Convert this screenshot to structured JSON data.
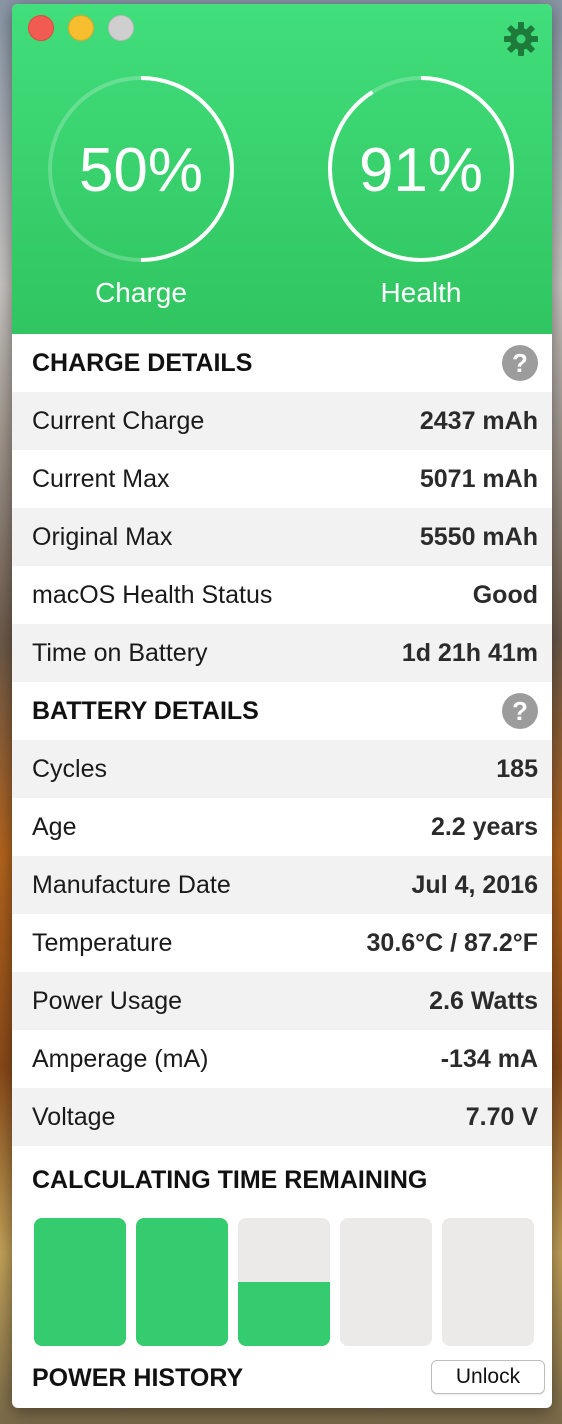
{
  "header": {
    "charge": {
      "value": "50%",
      "label": "Charge",
      "fraction": 0.5
    },
    "health": {
      "value": "91%",
      "label": "Health",
      "fraction": 0.91
    },
    "settings_icon": "gear-icon"
  },
  "charge_details": {
    "title": "CHARGE DETAILS",
    "help": "?",
    "rows": [
      {
        "label": "Current Charge",
        "value": "2437 mAh"
      },
      {
        "label": "Current Max",
        "value": "5071 mAh"
      },
      {
        "label": "Original Max",
        "value": "5550 mAh"
      },
      {
        "label": "macOS Health Status",
        "value": "Good"
      },
      {
        "label": "Time on Battery",
        "value": "1d 21h 41m"
      }
    ]
  },
  "battery_details": {
    "title": "BATTERY DETAILS",
    "help": "?",
    "rows": [
      {
        "label": "Cycles",
        "value": "185"
      },
      {
        "label": "Age",
        "value": "2.2 years"
      },
      {
        "label": "Manufacture Date",
        "value": "Jul 4, 2016"
      },
      {
        "label": "Temperature",
        "value": "30.6°C / 87.2°F"
      },
      {
        "label": "Power Usage",
        "value": "2.6 Watts"
      },
      {
        "label": "Amperage (mA)",
        "value": "-134 mA"
      },
      {
        "label": "Voltage",
        "value": "7.70 V"
      }
    ]
  },
  "time_remaining": {
    "title": "CALCULATING TIME REMAINING",
    "segments": [
      1.0,
      1.0,
      0.5,
      0.0,
      0.0
    ]
  },
  "power_history": {
    "title": "POWER HISTORY",
    "unlock_label": "Unlock"
  },
  "colors": {
    "accent": "#34cc6e",
    "header_top": "#41de7c",
    "header_bottom": "#30c560"
  }
}
